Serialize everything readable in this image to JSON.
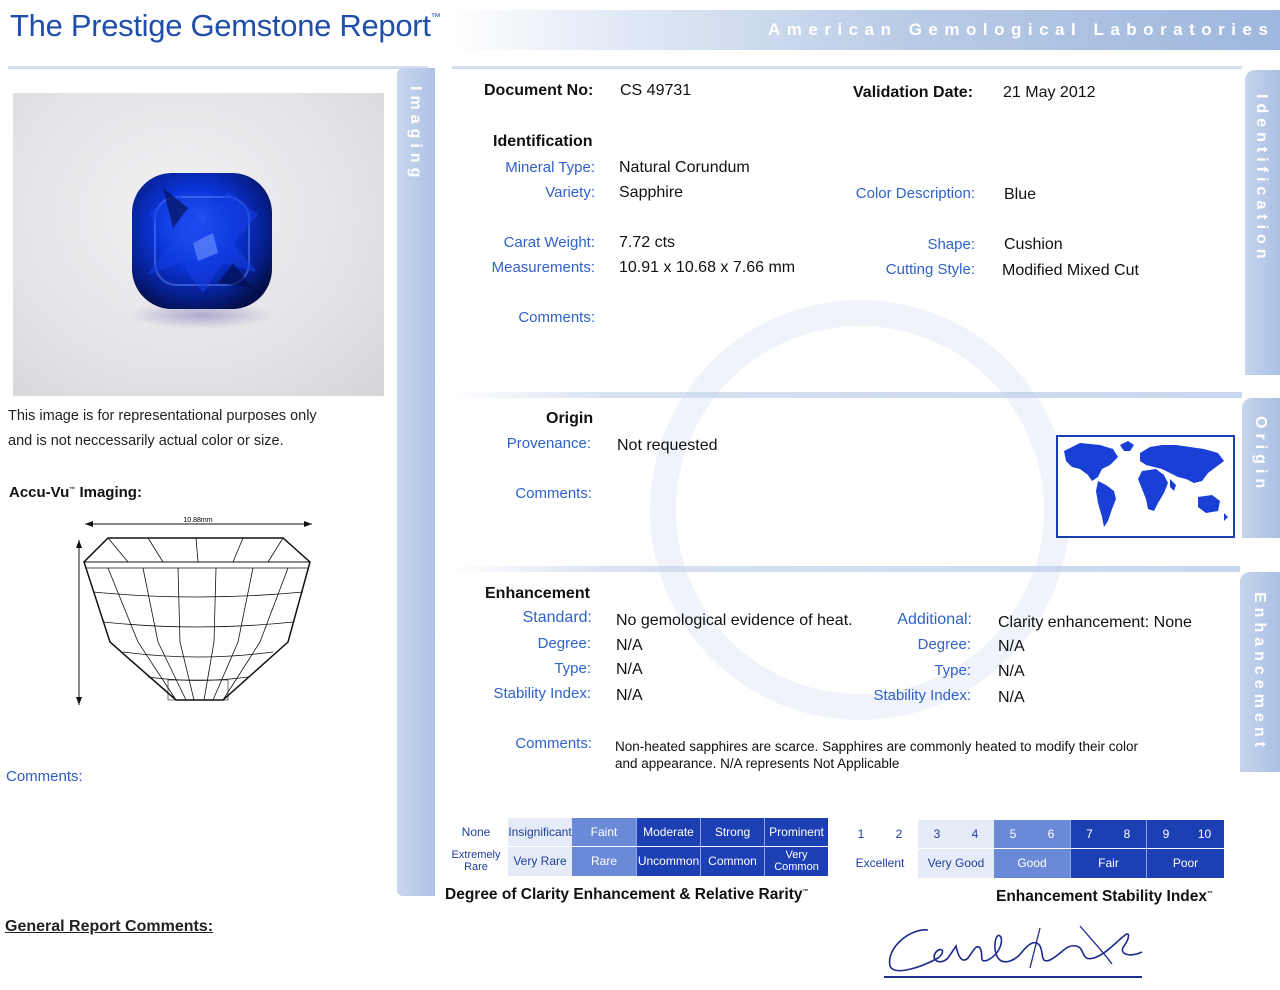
{
  "header": {
    "title": "The Prestige Gemstone Report",
    "title_mark": "™",
    "lab": "American Gemological Laboratories"
  },
  "side_tabs": {
    "imaging": "Imaging",
    "identification": "Identification",
    "origin": "Origin",
    "enhancement": "Enhancement"
  },
  "left": {
    "disclaimer_line1": "This image is for representational purposes only",
    "disclaimer_line2": "and is not neccessarily actual color or size.",
    "accu_vu": "Accu-Vu",
    "accu_vu_mark": "™",
    "accu_vu_suffix": " Imaging:",
    "diagram_width": "10.88mm",
    "comments_label": "Comments:",
    "general_comments_label": "General Report Comments:"
  },
  "document": {
    "doc_no_label": "Document No:",
    "doc_no": "CS 49731",
    "validation_label": "Validation Date:",
    "validation_date": "21 May 2012"
  },
  "identification": {
    "heading": "Identification",
    "mineral_type_label": "Mineral Type:",
    "mineral_type": "Natural Corundum",
    "variety_label": "Variety:",
    "variety": "Sapphire",
    "color_label": "Color Description:",
    "color": "Blue",
    "carat_label": "Carat Weight:",
    "carat": "7.72  cts",
    "shape_label": "Shape:",
    "shape": "Cushion",
    "measurements_label": "Measurements:",
    "measurements": "10.91 x 10.68 x 7.66  mm",
    "cutting_label": "Cutting Style:",
    "cutting": "Modified Mixed Cut",
    "comments_label": "Comments:"
  },
  "origin": {
    "heading": "Origin",
    "provenance_label": "Provenance:",
    "provenance": "Not requested",
    "comments_label": "Comments:"
  },
  "enhancement": {
    "heading": "Enhancement",
    "standard_label": "Standard:",
    "standard": "No gemological evidence of heat.",
    "additional_label": "Additional:",
    "additional": "Clarity enhancement: None",
    "degree_label": "Degree:",
    "degree": "N/A",
    "type_label": "Type:",
    "type": "N/A",
    "stability_label": "Stability Index:",
    "stability": "N/A",
    "add_degree": "N/A",
    "add_type": "N/A",
    "add_stability": "N/A",
    "comments_label": "Comments:",
    "comments_line1": "Non-heated sapphires are scarce. Sapphires are commonly heated to modify their color",
    "comments_line2": "and appearance. N/A represents Not Applicable"
  },
  "clarity_scale": {
    "title": "Degree of Clarity Enhancement & Relative Rarity",
    "title_mark": "™",
    "degrees": [
      "None",
      "Insignificant",
      "Faint",
      "Moderate",
      "Strong",
      "Prominent"
    ],
    "rarity": [
      "Extremely Rare",
      "Very Rare",
      "Rare",
      "Uncommon",
      "Common",
      "Very Common"
    ]
  },
  "stability_scale": {
    "title": "Enhancement Stability Index",
    "title_mark": "™",
    "numbers": [
      "1",
      "2",
      "3",
      "4",
      "5",
      "6",
      "7",
      "8",
      "9",
      "10"
    ],
    "grades": [
      "Excellent",
      "Very Good",
      "Good",
      "Fair",
      "Poor"
    ]
  }
}
